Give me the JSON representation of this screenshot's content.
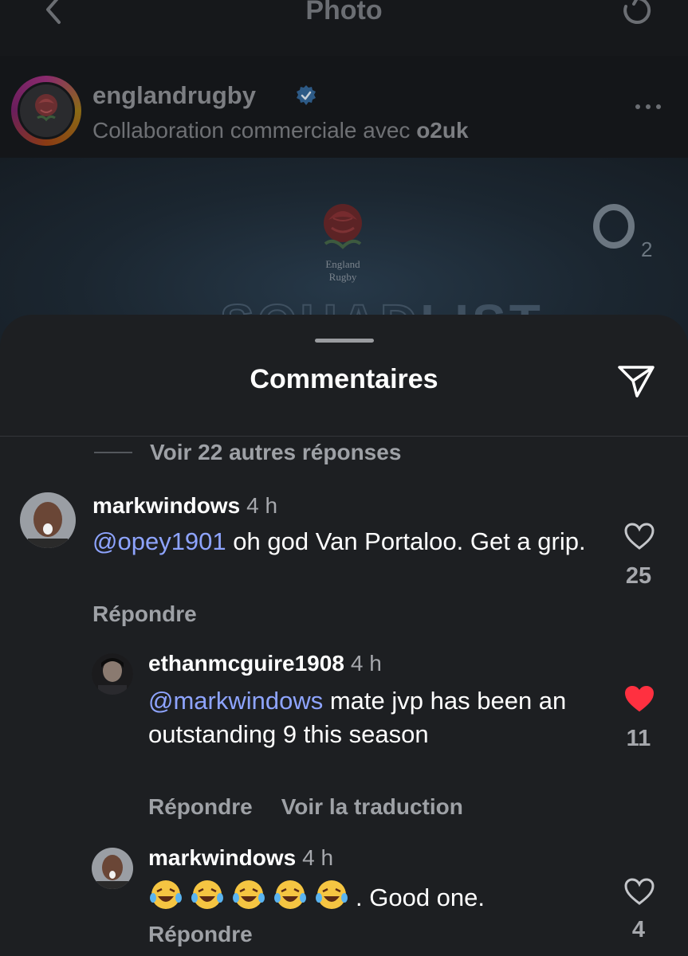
{
  "nav": {
    "title": "Photo"
  },
  "post": {
    "username": "englandrugby",
    "subtitle_prefix": "Collaboration commerciale avec",
    "partner": "o2uk",
    "image_logo_text": "England Rugby",
    "image_brand": "O2",
    "image_headline_partial": "SQUAD LIST"
  },
  "sheet": {
    "title": "Commentaires",
    "see_more_replies": "Voir 22 autres réponses"
  },
  "comments": [
    {
      "username": "markwindows",
      "time": "4 h",
      "mention": "@opey1901",
      "text": " oh god Van Portaloo. Get a grip.",
      "reply_label": "Répondre",
      "likes": "25",
      "liked": false
    },
    {
      "username": "ethanmcguire1908",
      "time": "4 h",
      "mention": "@markwindows",
      "text": " mate jvp has been an outstanding 9 this season",
      "reply_label": "Répondre",
      "translate_label": "Voir la traduction",
      "likes": "11",
      "liked": true
    },
    {
      "username": "markwindows",
      "time": "4 h",
      "emoji": "😂😂😂😂😂",
      "text": ". Good one.",
      "reply_label": "Répondre",
      "likes": "4",
      "liked": false
    }
  ],
  "colors": {
    "mention": "#8ea4ff",
    "liked_heart": "#ff3040",
    "sheet_bg": "#1d1f22"
  }
}
